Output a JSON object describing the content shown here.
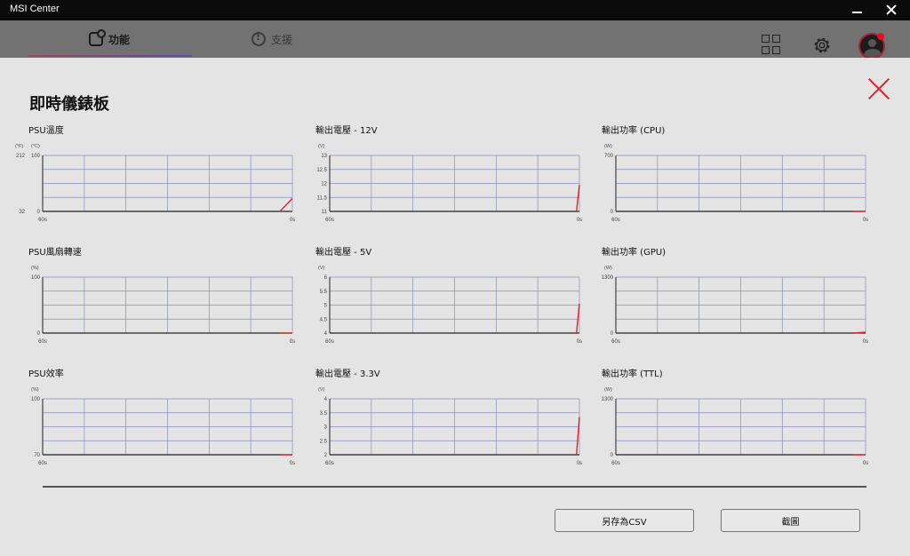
{
  "window": {
    "title": "MSI Center"
  },
  "header": {
    "tabs": [
      {
        "label": "功能",
        "active": true
      },
      {
        "label": "支援",
        "active": false
      }
    ],
    "icons": [
      "grid-icon",
      "gear-icon",
      "avatar"
    ]
  },
  "panel": {
    "title": "即時儀錶板",
    "buttons": {
      "save_csv": "另存為CSV",
      "screenshot": "截圖"
    }
  },
  "colors": {
    "accent": "#e02030",
    "grid": "#8a8fb8",
    "panel_bg": "#e4e4e4"
  },
  "chart_data": [
    {
      "type": "line",
      "title": "PSU溫度",
      "y_unit": "(°C)",
      "y2_unit": "(°F)",
      "yticks": [
        "100",
        "0"
      ],
      "y2ticks": [
        "212",
        "32"
      ],
      "ylim": [
        0,
        100
      ],
      "xlim_labels": [
        "60s",
        "0s"
      ],
      "x": [
        57,
        60
      ],
      "values": [
        0,
        23
      ]
    },
    {
      "type": "line",
      "title": "輸出電壓 - 12V",
      "y_unit": "(V)",
      "yticks": [
        "13",
        "12.5",
        "12",
        "11.5",
        "11"
      ],
      "ylim": [
        11,
        13
      ],
      "xlim_labels": [
        "60s",
        "0s"
      ],
      "x": [
        59.3,
        60
      ],
      "values": [
        11,
        11.95
      ]
    },
    {
      "type": "line",
      "title": "輸出功率 (CPU)",
      "y_unit": "(W)",
      "yticks": [
        "700",
        "0"
      ],
      "ylim": [
        0,
        700
      ],
      "xlim_labels": [
        "60s",
        "0s"
      ],
      "x": [
        57,
        60
      ],
      "values": [
        0,
        0
      ]
    },
    {
      "type": "line",
      "title": "PSU風扇轉速",
      "y_unit": "(%)",
      "yticks": [
        "100",
        "0"
      ],
      "ylim": [
        0,
        100
      ],
      "xlim_labels": [
        "60s",
        "0s"
      ],
      "x": [
        57,
        60
      ],
      "values": [
        0,
        0
      ]
    },
    {
      "type": "line",
      "title": "輸出電壓 - 5V",
      "y_unit": "(V)",
      "yticks": [
        "6",
        "5.5",
        "5",
        "4.5",
        "4"
      ],
      "ylim": [
        4,
        6
      ],
      "xlim_labels": [
        "60s",
        "0s"
      ],
      "x": [
        59.3,
        60
      ],
      "values": [
        4,
        5.05
      ]
    },
    {
      "type": "line",
      "title": "輸出功率 (GPU)",
      "y_unit": "(W)",
      "yticks": [
        "1300",
        "0"
      ],
      "ylim": [
        0,
        1300
      ],
      "xlim_labels": [
        "60s",
        "0s"
      ],
      "x": [
        57,
        60
      ],
      "values": [
        0,
        20
      ]
    },
    {
      "type": "line",
      "title": "PSU效率",
      "y_unit": "(%)",
      "yticks": [
        "100",
        "70"
      ],
      "ylim": [
        70,
        100
      ],
      "xlim_labels": [
        "60s",
        "0s"
      ],
      "x": [
        57,
        60
      ],
      "values": [
        70,
        70
      ]
    },
    {
      "type": "line",
      "title": "輸出電壓 - 3.3V",
      "y_unit": "(V)",
      "yticks": [
        "4",
        "3.5",
        "3",
        "2.5",
        "2"
      ],
      "ylim": [
        2,
        4
      ],
      "xlim_labels": [
        "60s",
        "0s"
      ],
      "x": [
        59.3,
        60
      ],
      "values": [
        2,
        3.35
      ]
    },
    {
      "type": "line",
      "title": "輸出功率 (TTL)",
      "y_unit": "(W)",
      "yticks": [
        "1300",
        "0"
      ],
      "ylim": [
        0,
        1300
      ],
      "xlim_labels": [
        "60s",
        "0s"
      ],
      "x": [
        57,
        60
      ],
      "values": [
        0,
        0
      ]
    }
  ]
}
